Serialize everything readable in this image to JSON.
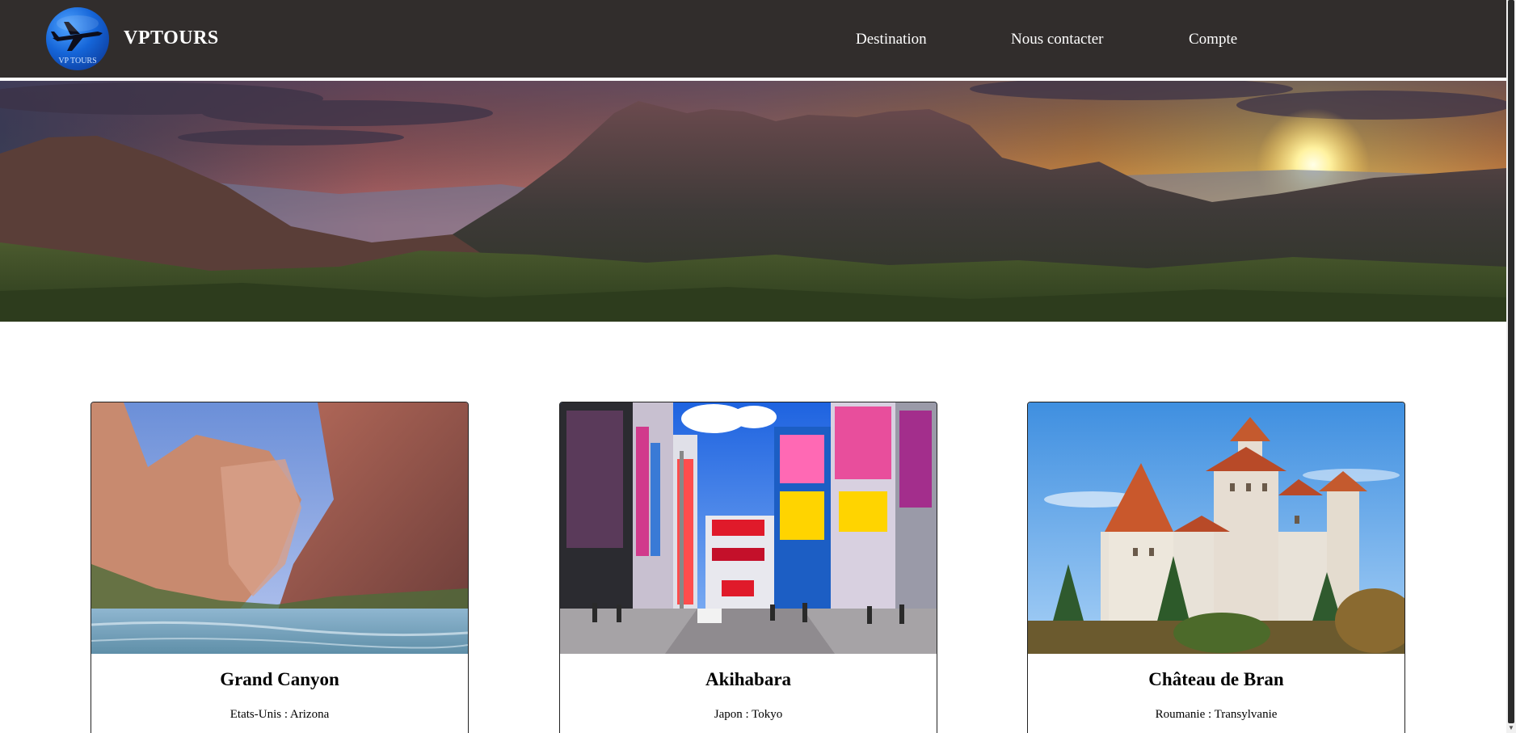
{
  "header": {
    "brand": "VPTOURS",
    "logo_text": "VP TOURS",
    "nav": {
      "destination": "Destination",
      "contact": "Nous contacter",
      "account": "Compte"
    },
    "colors": {
      "background": "#312d2c",
      "text": "#ffffff"
    }
  },
  "hero": {
    "icon": "mountain-sunset-banner"
  },
  "cards": [
    {
      "title": "Grand Canyon",
      "subtitle": "Etats-Unis : Arizona"
    },
    {
      "title": "Akihabara",
      "subtitle": "Japon : Tokyo"
    },
    {
      "title": "Château de Bran",
      "subtitle": "Roumanie : Transylvanie"
    }
  ]
}
